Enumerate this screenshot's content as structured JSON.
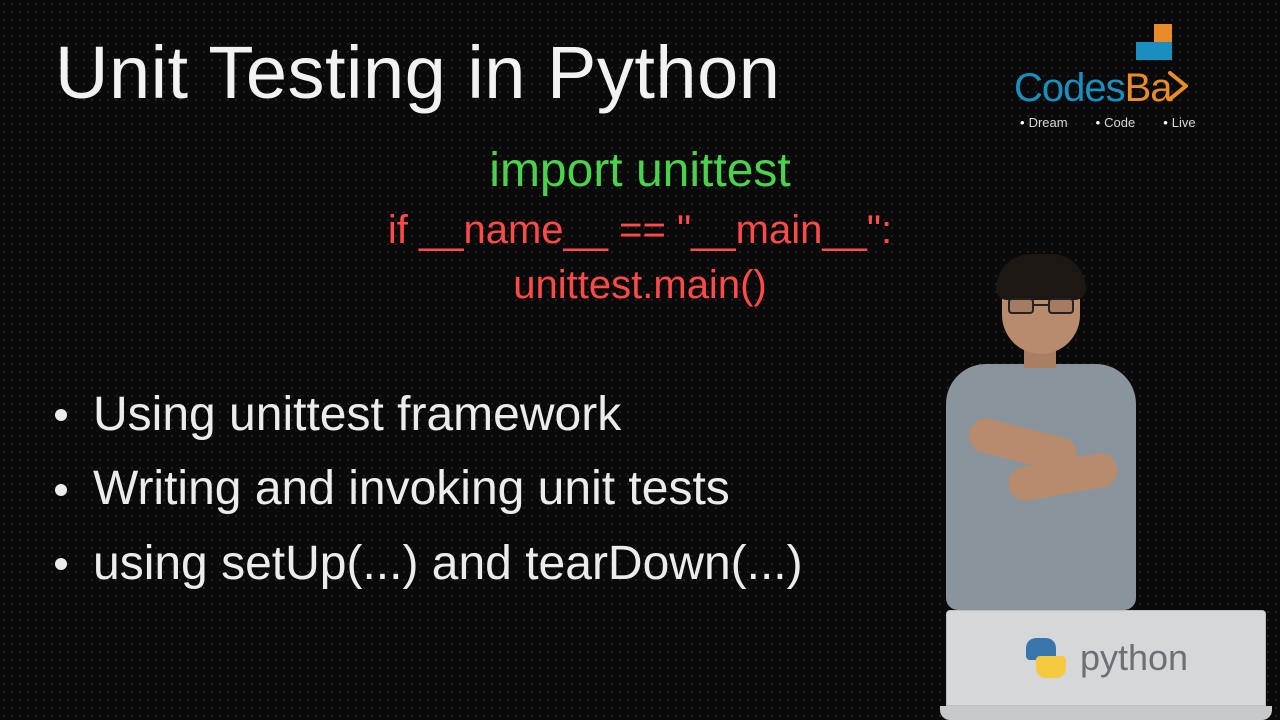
{
  "title": "Unit Testing in Python",
  "code": {
    "import_line": "import unittest",
    "main_guard": "if __name__ == \"__main__\":",
    "main_call": "unittest.main()"
  },
  "bullets": [
    "Using unittest framework",
    "Writing and invoking unit tests",
    "using setUp(...) and tearDown(...)"
  ],
  "logo": {
    "brand_part1": "Codes",
    "brand_part2": "Ba",
    "taglines": [
      "Dream",
      "Code",
      "Live"
    ],
    "colors": {
      "primary": "#1a8fbf",
      "accent": "#e98b28"
    }
  },
  "laptop": {
    "label": "python"
  }
}
